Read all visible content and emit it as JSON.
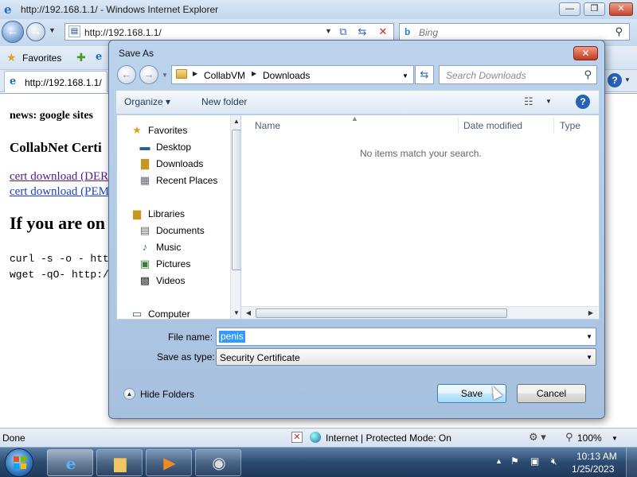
{
  "browser": {
    "title": "http://192.168.1.1/ - Windows Internet Explorer",
    "address": "http://192.168.1.1/",
    "search_placeholder": "Bing",
    "favorites_label": "Favorites",
    "tab_label": "http://192.168.1.1/",
    "status_left": "Done",
    "status_zone": "Internet | Protected Mode: On",
    "zoom": "100%"
  },
  "page": {
    "news": "news: google sites",
    "heading_collabnet": "CollabNet Certi",
    "link_der": "cert download (DER",
    "link_pem": "cert download (PEM",
    "heading_if": "If you are on",
    "code_curl": "curl -s -o - htt",
    "code_wget": "wget -qO- http:/"
  },
  "dialog": {
    "title": "Save As",
    "breadcrumb": [
      "CollabVM",
      "Downloads"
    ],
    "search_placeholder": "Search Downloads",
    "toolbar": {
      "organize": "Organize",
      "new_folder": "New folder"
    },
    "nav": {
      "favorites": "Favorites",
      "desktop": "Desktop",
      "downloads": "Downloads",
      "recent": "Recent Places",
      "libraries": "Libraries",
      "documents": "Documents",
      "music": "Music",
      "pictures": "Pictures",
      "videos": "Videos",
      "computer": "Computer"
    },
    "columns": {
      "name": "Name",
      "date": "Date modified",
      "type": "Type"
    },
    "empty_message": "No items match your search.",
    "file_name_label": "File name:",
    "file_name_value": "penis",
    "save_type_label": "Save as type:",
    "save_type_value": "Security Certificate",
    "hide_folders": "Hide Folders",
    "save_button": "Save",
    "cancel_button": "Cancel"
  },
  "taskbar": {
    "time": "10:13 AM",
    "date": "1/25/2023"
  }
}
